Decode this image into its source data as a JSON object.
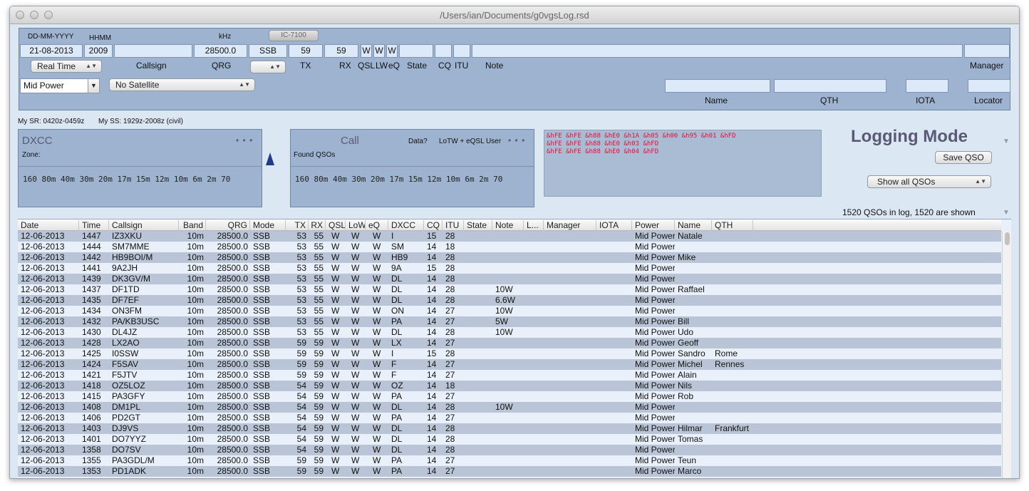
{
  "window": {
    "title": "/Users/ian/Documents/g0vgsLog.rsd"
  },
  "entry": {
    "date_label": "DD-MM-YYYY",
    "time_label": "HHMM",
    "khz_label": "kHz",
    "rig_button": "IC-7100",
    "date_value": "21-08-2013",
    "time_value": "2009",
    "callsign_value": "",
    "qrg_value": "28500.0",
    "mode_value": "SSB",
    "tx_value": "59",
    "rx_value": "59",
    "qsl_value": "W",
    "lw_value": "W",
    "eq_value": "W",
    "realtime_select": "Real Time",
    "callsign_label": "Callsign",
    "qrg_label": "QRG",
    "tx_label": "TX",
    "rx_label": "RX",
    "qsl_label": "QSL",
    "lw_label": "LW",
    "eq_label": "eQ",
    "state_label": "State",
    "cq_label": "CQ",
    "itu_label": "ITU",
    "note_label": "Note",
    "manager_label": "Manager",
    "power_select": "Mid Power",
    "satellite_select": "No Satellite",
    "name_label": "Name",
    "qth_label": "QTH",
    "iota_label": "IOTA",
    "locator_label": "Locator"
  },
  "sun": {
    "sr": "My SR: 0420z-0459z",
    "ss": "My SS: 1929z-2008z (civil)"
  },
  "dxcc_panel": {
    "title": "DXCC",
    "dots": "• • •",
    "zone_label": "Zone:",
    "bands": "160  80m  40m  30m  20m  17m  15m  12m  10m   6m   2m  70"
  },
  "call_panel": {
    "title": "Call",
    "data_label": "Data?",
    "lotw_label": "LoTW + eQSL User",
    "dots": "• • •",
    "found_label": "Found QSOs",
    "bands": "160  80m  40m  30m  20m  17m  15m  12m  10m   6m   2m  70"
  },
  "hex": {
    "lines": [
      "&hFE &hFE &h88 &hE0 &h1A &h05 &h00 &h95 &h01 &hFD",
      "&hFE &hFE &h88 &hE0 &h03 &hFD",
      "&hFE &hFE &h88 &hE0 &h04 &hFD"
    ]
  },
  "logging": {
    "title": "Logging Mode",
    "save_button": "Save QSO",
    "show_select": "Show all QSOs",
    "status": "1520 QSOs in log, 1520 are shown"
  },
  "table": {
    "headers": [
      "Date",
      "Time",
      "Callsign",
      "Band",
      "QRG",
      "Mode",
      "TX",
      "RX",
      "QSL",
      "LoW",
      "eQ",
      "DXCC",
      "CQ",
      "ITU",
      "State",
      "Note",
      "L...",
      "Manager",
      "IOTA",
      "Power",
      "Name",
      "QTH"
    ],
    "rows": [
      [
        "12-06-2013",
        "1447",
        "IZ3XKU",
        "10m",
        "28500.0",
        "SSB",
        "53",
        "55",
        "W",
        "W",
        "W",
        "I",
        "15",
        "28",
        "",
        "",
        "",
        "",
        "",
        "Mid Power",
        "Natale",
        ""
      ],
      [
        "12-06-2013",
        "1444",
        "SM7MME",
        "10m",
        "28500.0",
        "SSB",
        "53",
        "55",
        "W",
        "W",
        "W",
        "SM",
        "14",
        "18",
        "",
        "",
        "",
        "",
        "",
        "Mid Power",
        "",
        ""
      ],
      [
        "12-06-2013",
        "1442",
        "HB9BOI/M",
        "10m",
        "28500.0",
        "SSB",
        "53",
        "55",
        "W",
        "W",
        "W",
        "HB9",
        "14",
        "28",
        "",
        "",
        "",
        "",
        "",
        "Mid Power",
        "Mike",
        ""
      ],
      [
        "12-06-2013",
        "1441",
        "9A2JH",
        "10m",
        "28500.0",
        "SSB",
        "53",
        "55",
        "W",
        "W",
        "W",
        "9A",
        "15",
        "28",
        "",
        "",
        "",
        "",
        "",
        "Mid Power",
        "",
        ""
      ],
      [
        "12-06-2013",
        "1439",
        "DK3GV/M",
        "10m",
        "28500.0",
        "SSB",
        "53",
        "55",
        "W",
        "W",
        "W",
        "DL",
        "14",
        "28",
        "",
        "",
        "",
        "",
        "",
        "Mid Power",
        "",
        ""
      ],
      [
        "12-06-2013",
        "1437",
        "DF1TD",
        "10m",
        "28500.0",
        "SSB",
        "53",
        "55",
        "W",
        "W",
        "W",
        "DL",
        "14",
        "28",
        "",
        "10W",
        "",
        "",
        "",
        "Mid Power",
        "Raffael",
        ""
      ],
      [
        "12-06-2013",
        "1435",
        "DF7EF",
        "10m",
        "28500.0",
        "SSB",
        "53",
        "55",
        "W",
        "W",
        "W",
        "DL",
        "14",
        "28",
        "",
        "6.6W",
        "",
        "",
        "",
        "Mid Power",
        "",
        ""
      ],
      [
        "12-06-2013",
        "1434",
        "ON3FM",
        "10m",
        "28500.0",
        "SSB",
        "53",
        "55",
        "W",
        "W",
        "W",
        "ON",
        "14",
        "27",
        "",
        "10W",
        "",
        "",
        "",
        "Mid Power",
        "",
        ""
      ],
      [
        "12-06-2013",
        "1432",
        "PA/KB3USC",
        "10m",
        "28500.0",
        "SSB",
        "53",
        "55",
        "W",
        "W",
        "W",
        "PA",
        "14",
        "27",
        "",
        "5W",
        "",
        "",
        "",
        "Mid Power",
        "Bill",
        ""
      ],
      [
        "12-06-2013",
        "1430",
        "DL4JZ",
        "10m",
        "28500.0",
        "SSB",
        "53",
        "55",
        "W",
        "W",
        "W",
        "DL",
        "14",
        "28",
        "",
        "10W",
        "",
        "",
        "",
        "Mid Power",
        "Udo",
        ""
      ],
      [
        "12-06-2013",
        "1428",
        "LX2AO",
        "10m",
        "28500.0",
        "SSB",
        "59",
        "59",
        "W",
        "W",
        "W",
        "LX",
        "14",
        "27",
        "",
        "",
        "",
        "",
        "",
        "Mid Power",
        "Geoff",
        ""
      ],
      [
        "12-06-2013",
        "1425",
        "I0SSW",
        "10m",
        "28500.0",
        "SSB",
        "59",
        "59",
        "W",
        "W",
        "W",
        "I",
        "15",
        "28",
        "",
        "",
        "",
        "",
        "",
        "Mid Power",
        "Sandro",
        "Rome"
      ],
      [
        "12-06-2013",
        "1424",
        "F5SAV",
        "10m",
        "28500.0",
        "SSB",
        "59",
        "59",
        "W",
        "W",
        "W",
        "F",
        "14",
        "27",
        "",
        "",
        "",
        "",
        "",
        "Mid Power",
        "Michel",
        "Rennes"
      ],
      [
        "12-06-2013",
        "1421",
        "F5JTV",
        "10m",
        "28500.0",
        "SSB",
        "59",
        "59",
        "W",
        "W",
        "W",
        "F",
        "14",
        "27",
        "",
        "",
        "",
        "",
        "",
        "Mid Power",
        "Alain",
        ""
      ],
      [
        "12-06-2013",
        "1418",
        "OZ5LOZ",
        "10m",
        "28500.0",
        "SSB",
        "54",
        "59",
        "W",
        "W",
        "W",
        "OZ",
        "14",
        "18",
        "",
        "",
        "",
        "",
        "",
        "Mid Power",
        "Nils",
        ""
      ],
      [
        "12-06-2013",
        "1415",
        "PA3GFY",
        "10m",
        "28500.0",
        "SSB",
        "54",
        "59",
        "W",
        "W",
        "W",
        "PA",
        "14",
        "27",
        "",
        "",
        "",
        "",
        "",
        "Mid Power",
        "Rob",
        ""
      ],
      [
        "12-06-2013",
        "1408",
        "DM1PL",
        "10m",
        "28500.0",
        "SSB",
        "54",
        "59",
        "W",
        "W",
        "W",
        "DL",
        "14",
        "28",
        "",
        "10W",
        "",
        "",
        "",
        "Mid Power",
        "",
        ""
      ],
      [
        "12-06-2013",
        "1406",
        "PD2GT",
        "10m",
        "28500.0",
        "SSB",
        "54",
        "59",
        "W",
        "W",
        "W",
        "PA",
        "14",
        "27",
        "",
        "",
        "",
        "",
        "",
        "Mid Power",
        "",
        ""
      ],
      [
        "12-06-2013",
        "1403",
        "DJ9VS",
        "10m",
        "28500.0",
        "SSB",
        "54",
        "59",
        "W",
        "W",
        "W",
        "DL",
        "14",
        "28",
        "",
        "",
        "",
        "",
        "",
        "Mid Power",
        "Hilmar",
        "Frankfurt"
      ],
      [
        "12-06-2013",
        "1401",
        "DO7YYZ",
        "10m",
        "28500.0",
        "SSB",
        "54",
        "59",
        "W",
        "W",
        "W",
        "DL",
        "14",
        "28",
        "",
        "",
        "",
        "",
        "",
        "Mid Power",
        "Tomas",
        ""
      ],
      [
        "12-06-2013",
        "1358",
        "DO7SV",
        "10m",
        "28500.0",
        "SSB",
        "54",
        "59",
        "W",
        "W",
        "W",
        "DL",
        "14",
        "28",
        "",
        "",
        "",
        "",
        "",
        "Mid Power",
        "",
        ""
      ],
      [
        "12-06-2013",
        "1355",
        "PA3GDL/M",
        "10m",
        "28500.0",
        "SSB",
        "59",
        "59",
        "W",
        "W",
        "W",
        "PA",
        "14",
        "27",
        "",
        "",
        "",
        "",
        "",
        "Mid Power",
        "Teun",
        ""
      ],
      [
        "12-06-2013",
        "1353",
        "PD1ADK",
        "10m",
        "28500.0",
        "SSB",
        "59",
        "59",
        "W",
        "W",
        "W",
        "PA",
        "14",
        "27",
        "",
        "",
        "",
        "",
        "",
        "Mid Power",
        "Marco",
        ""
      ]
    ]
  }
}
